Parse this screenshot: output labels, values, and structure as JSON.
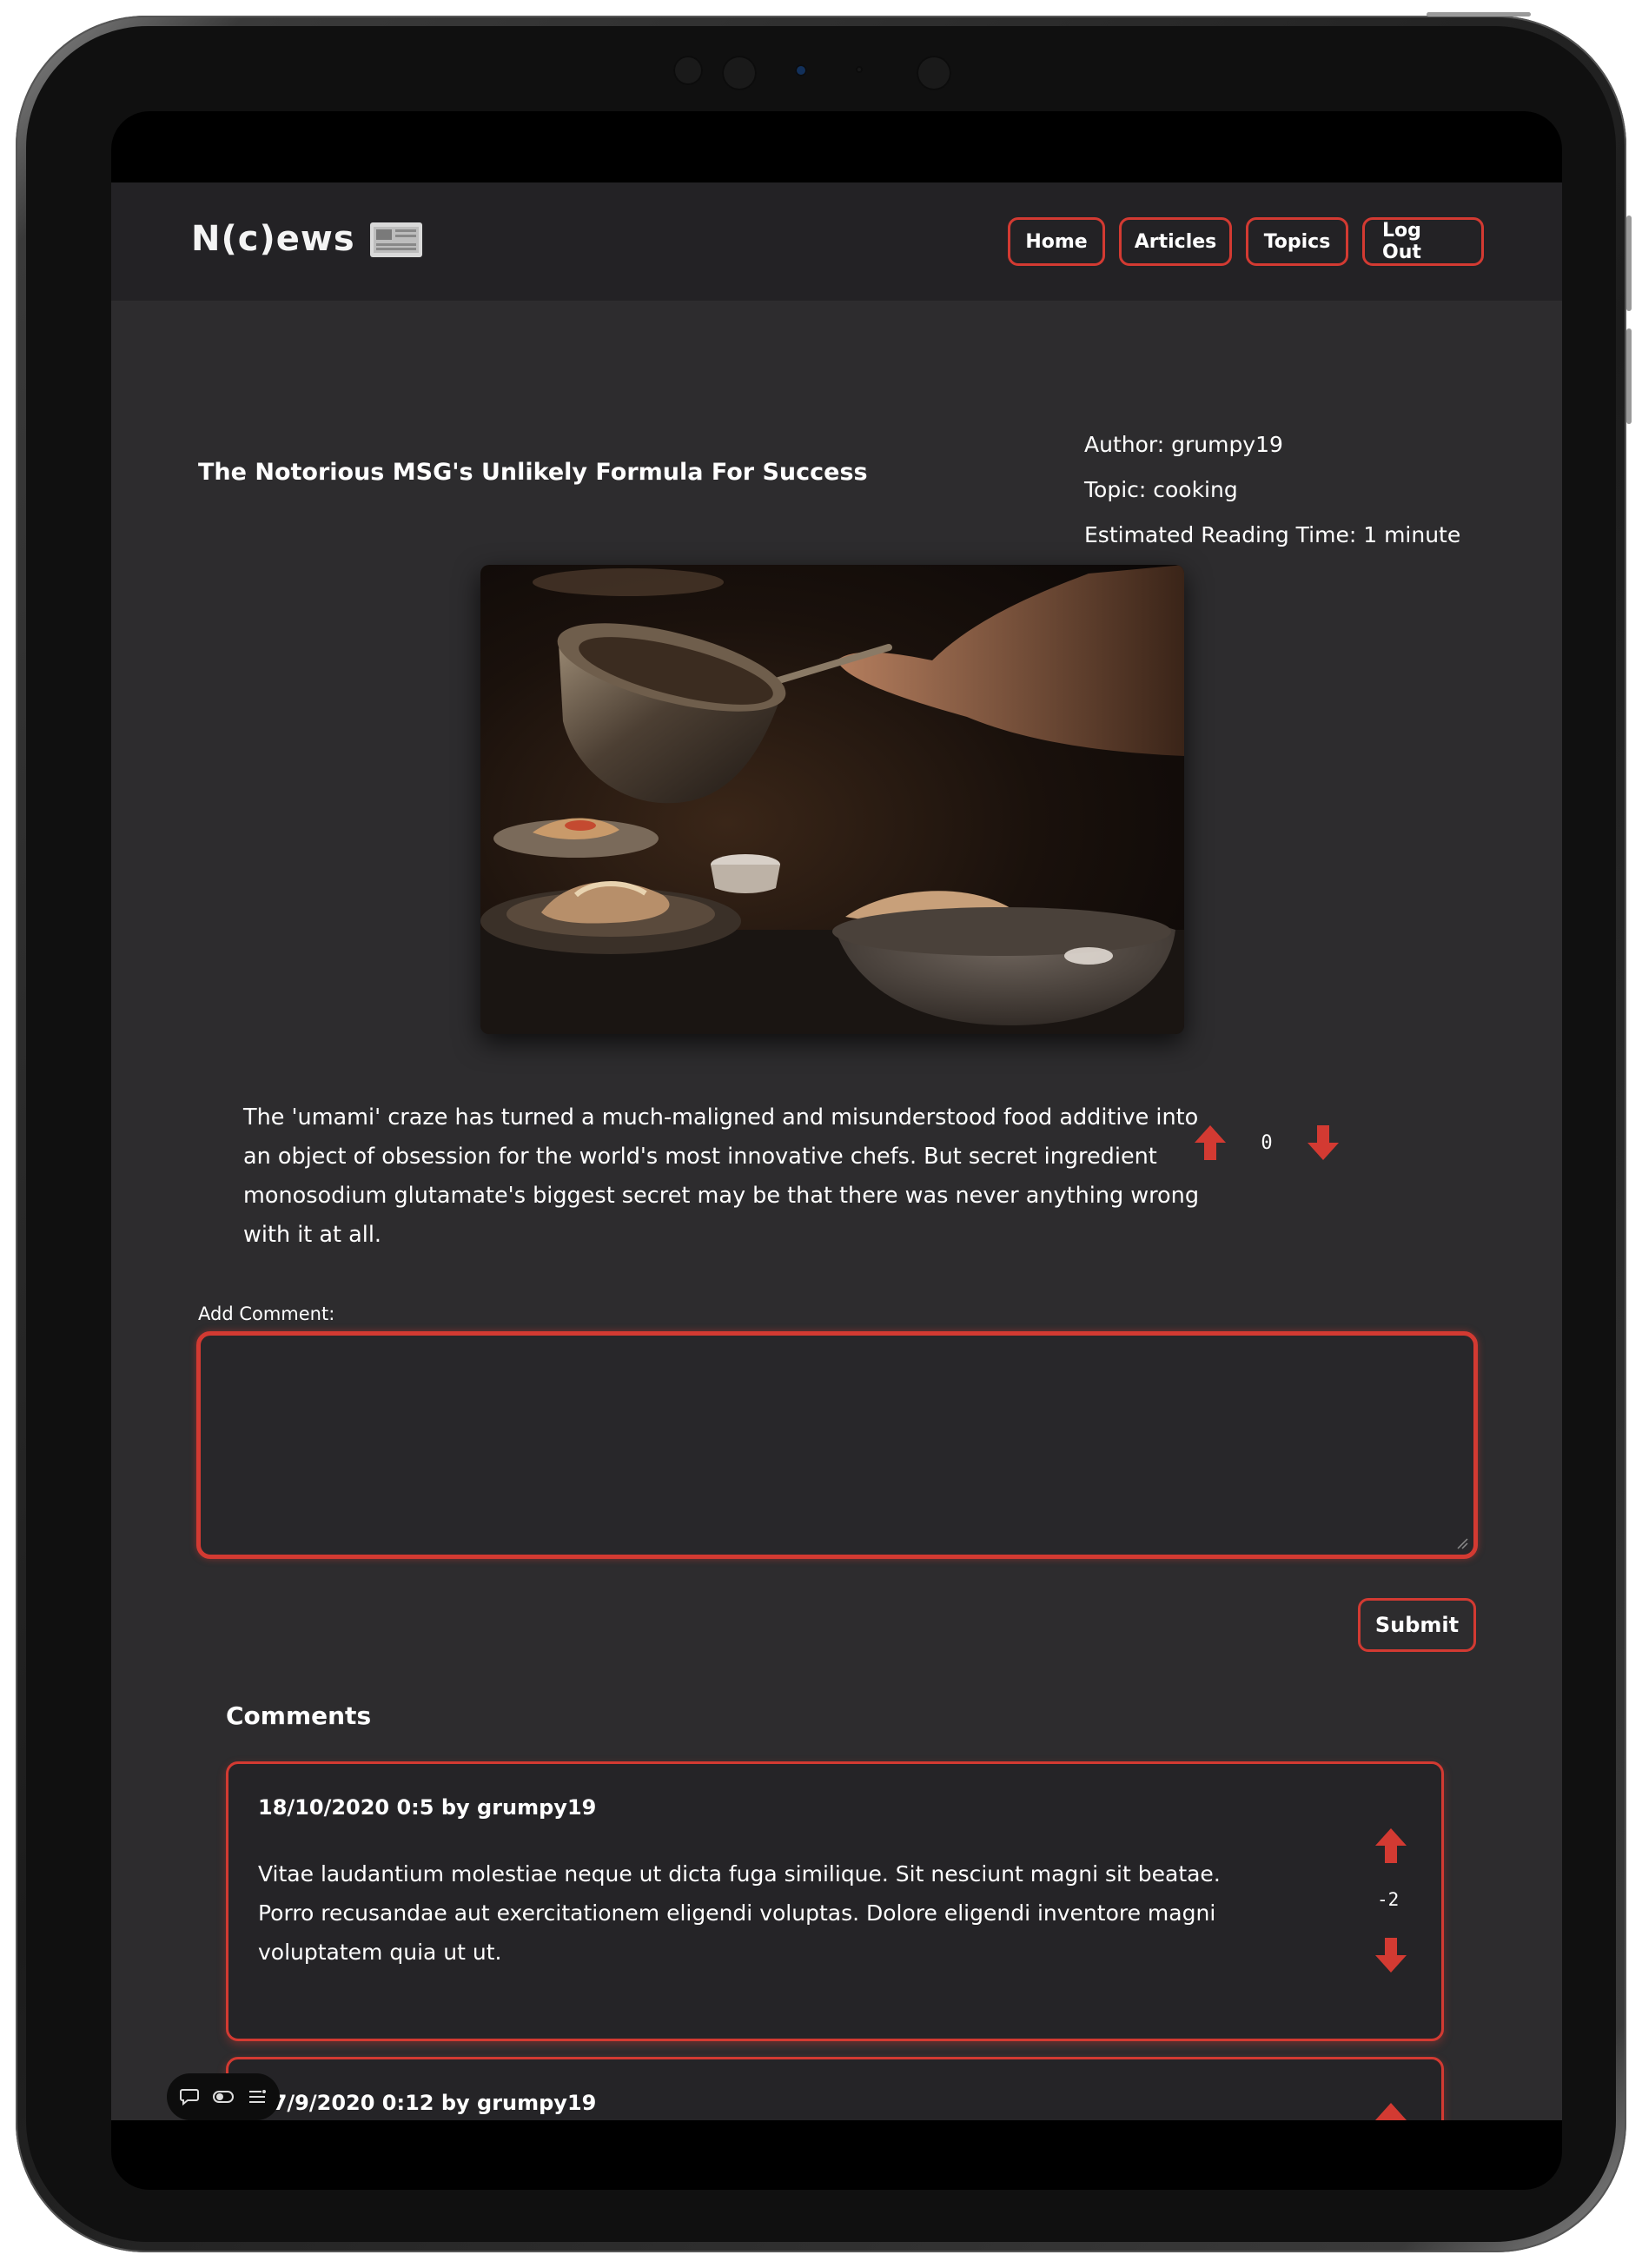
{
  "app": {
    "logo_text": "N(c)ews",
    "logo_icon": "newspaper-icon"
  },
  "nav": {
    "items": [
      {
        "label": "Home"
      },
      {
        "label": "Articles"
      },
      {
        "label": "Topics"
      },
      {
        "label": "Log Out"
      }
    ]
  },
  "article": {
    "title": "The Notorious MSG's Unlikely Formula For Success",
    "author": "Author: grumpy19",
    "topic": "Topic: cooking",
    "reading_time": "Estimated Reading Time: 1 minute",
    "body": "The 'umami' craze has turned a much-maligned and misunderstood food additive into an object of obsession for the world's most innovative chefs. But secret ingredient monosodium glutamate's biggest secret may be that there was never anything wrong with it at all.",
    "votes": "0"
  },
  "comment_form": {
    "label": "Add Comment:",
    "value": "",
    "submit_label": "Submit"
  },
  "comments": {
    "heading": "Comments",
    "items": [
      {
        "header": "18/10/2020 0:5 by grumpy19",
        "body": "Vitae laudantium molestiae neque ut dicta fuga similique. Sit nesciunt magni sit beatae. Porro recusandae aut exercitationem eligendi voluptas. Dolore eligendi inventore magni voluptatem quia ut ut.",
        "votes": "-2"
      },
      {
        "header": "17/9/2020 0:12 by grumpy19",
        "body": "",
        "votes": ""
      }
    ]
  },
  "colors": {
    "accent": "#d33a32",
    "page_bg": "#2d2c2e",
    "header_bg": "#232225"
  },
  "overlay_icons": [
    "speech-bubble-icon",
    "toggle-icon",
    "list-icon"
  ]
}
